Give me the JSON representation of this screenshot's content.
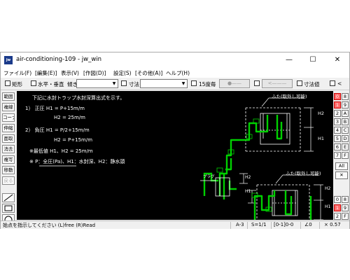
{
  "window": {
    "title": "air-conditioning-109 - jw_win",
    "icon_label": "jw",
    "controls": {
      "minimize": "—",
      "maximize": "☐",
      "close": "✕"
    }
  },
  "menu": [
    "ファイル(F)",
    "[編集(E)]",
    "表示(V)",
    "[作図(D)]",
    "設定(S)",
    "[その他(A)]",
    "ヘルプ(H)"
  ],
  "toolbar": {
    "rect_label": "矩形",
    "hv_label": "水平・垂直",
    "tilt_label": "傾き",
    "dim_label": "寸法",
    "deg15_label": "15度毎",
    "circle_btn": "●——",
    "arrow_btn": "<———",
    "dimval_label": "寸法値",
    "lt_label": "<"
  },
  "left_tools": [
    "範囲",
    "複線",
    "コーナー",
    "伸縮",
    "面取",
    "消去",
    "複写",
    "移動",
    "戻る"
  ],
  "right_tools": {
    "layer_group_top": [
      "0",
      "1",
      "2",
      "3",
      "4",
      "5",
      "6",
      "7"
    ],
    "layer_group_right": [
      "8",
      "9",
      "A",
      "B",
      "C",
      "D",
      "E",
      "F"
    ],
    "all_label": "All",
    "x_label": "✕",
    "lower_left": [
      "0",
      "1",
      "2"
    ],
    "lower_right": [
      "8",
      "9",
      "F"
    ]
  },
  "canvas": {
    "lines": [
      "下記に水封トラップ水封深算出式を示す。",
      "1） 正圧  H1 = P+15m/m",
      "H2 =   25m/m",
      "2） 負圧  H1 = P/2+15m/m",
      "H2 =   P+15m/m",
      "※最低値 H1、H2 = 25m/m",
      "※  P：全圧(Pa)、H1：水封深、H2：静水頭"
    ],
    "drawing_labels": {
      "lid_top": "ふた(取外し可能)",
      "lid_bottom": "ふた(取外し可能)",
      "plug": "プラグ",
      "h1": "H1",
      "h2": "H2"
    }
  },
  "status": {
    "message": "始点を指示してください (L)free (R)Read",
    "paper": "A-3",
    "scale": "S=1/1",
    "layer": "[0-1]0-0",
    "angle": "∠0",
    "zoom": "× 0.57"
  },
  "colors": {
    "canvas_bg": "#000000",
    "text": "#ffffff",
    "pipe": "#00d000",
    "dimension": "#ffffff",
    "selected_layer": "#ff6a6a"
  }
}
